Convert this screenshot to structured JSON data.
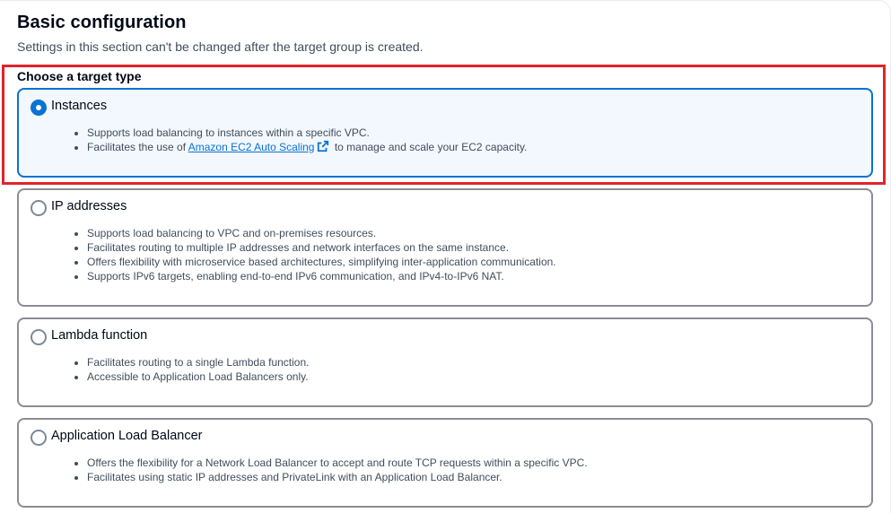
{
  "section": {
    "title": "Basic configuration",
    "subtitle": "Settings in this section can't be changed after the target group is created."
  },
  "target_type": {
    "label": "Choose a target type",
    "selected": "instances",
    "options": [
      {
        "id": "instances",
        "title": "Instances",
        "bullets": [
          "Supports load balancing to instances within a specific VPC."
        ],
        "bullet_with_link": {
          "prefix": "Facilitates the use of ",
          "link_text": "Amazon EC2 Auto Scaling",
          "suffix": " to manage and scale your EC2 capacity.",
          "icon": "external-link-icon"
        }
      },
      {
        "id": "ip",
        "title": "IP addresses",
        "bullets": [
          "Supports load balancing to VPC and on-premises resources.",
          "Facilitates routing to multiple IP addresses and network interfaces on the same instance.",
          "Offers flexibility with microservice based architectures, simplifying inter-application communication.",
          "Supports IPv6 targets, enabling end-to-end IPv6 communication, and IPv4-to-IPv6 NAT."
        ]
      },
      {
        "id": "lambda",
        "title": "Lambda function",
        "bullets": [
          "Facilitates routing to a single Lambda function.",
          "Accessible to Application Load Balancers only."
        ]
      },
      {
        "id": "alb",
        "title": "Application Load Balancer",
        "bullets": [
          "Offers the flexibility for a Network Load Balancer to accept and route TCP requests within a specific VPC.",
          "Facilitates using static IP addresses and PrivateLink with an Application Load Balancer."
        ]
      }
    ]
  },
  "colors": {
    "accent": "#0972d3",
    "selected_bg": "#f2f8fd",
    "highlight": "#e0242b",
    "border": "#8c8c94"
  }
}
